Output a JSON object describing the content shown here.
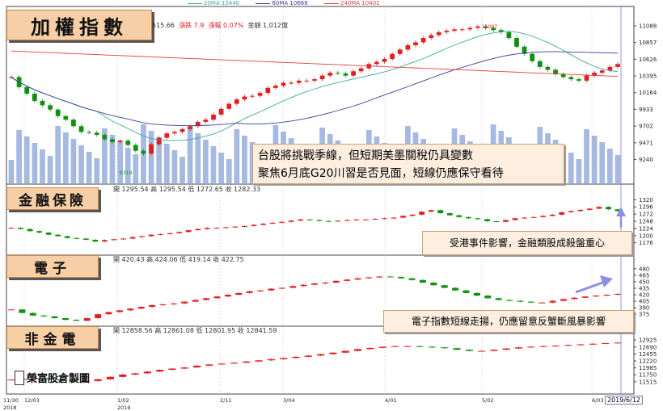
{
  "legend": [
    {
      "label": "20MA 10440",
      "color": "#3aaa9a"
    },
    {
      "label": "60MA 10668",
      "color": "#3b3b9e"
    },
    {
      "label": "240MA 10401",
      "color": "#e04040"
    }
  ],
  "titles": {
    "taiex": "加權指數",
    "finance": "金融保險",
    "electronics": "電子",
    "nonfin": "非金電"
  },
  "info": {
    "taiex": {
      "close": "515.66",
      "change": "漲跌 7.9",
      "pct": "漲幅 0.07%",
      "volume": "金額 1,012億"
    },
    "finance": "開 1295.54 高 1295.54 低 1272.65 收 1282.33",
    "electronics": "開 420.43 高 424.06 低 419.14 收 422.75",
    "nonfin": "開 12858.56 高 12861.08 低 12801.95 收 12841.59"
  },
  "callouts": {
    "taiex_line1": "台股將挑戰季線，但短期美墨關稅仍具變數",
    "taiex_line2": "聚焦6月底G20川習是否見面，短線仍應保守看待",
    "finance": "受港事件影響，金融類股成殺盤重心",
    "electronics": "電子指數短線走揚，仍應留意反蟹斷風暴影響"
  },
  "logo_text": "榮富股倉製圖",
  "date_label": "2019/6/12",
  "colors": {
    "up": "#e02020",
    "down": "#109010",
    "ma20": "#3aaa9a",
    "ma60": "#3b3b9e",
    "ma240": "#e04040",
    "volume": "#90a8d8",
    "arrow": "#8f8fe6"
  },
  "chart_data": [
    {
      "type": "candlestick",
      "name": "加權指數",
      "ylim": [
        9100,
        11200
      ],
      "y_ticks": [
        11088,
        10857,
        10626,
        10395,
        10164,
        9933,
        9702,
        9471,
        9240
      ],
      "x_labels": [
        "11/30 2018",
        "12/03",
        "1/02 2019",
        "2/11",
        "3/04",
        "4/01",
        "5/02",
        "6/03"
      ],
      "annotations": {
        "high": "11097",
        "low": "9319"
      },
      "close_series": [
        10380,
        10240,
        10150,
        10050,
        9990,
        9930,
        9840,
        9790,
        9700,
        9620,
        9610,
        9580,
        9520,
        9480,
        9500,
        9440,
        9360,
        9320,
        9450,
        9540,
        9600,
        9620,
        9660,
        9700,
        9760,
        9790,
        9860,
        9940,
        10010,
        10070,
        10110,
        10120,
        10160,
        10230,
        10260,
        10300,
        10300,
        10330,
        10330,
        10350,
        10400,
        10440,
        10430,
        10400,
        10460,
        10500,
        10560,
        10590,
        10630,
        10700,
        10760,
        10820,
        10860,
        10920,
        10960,
        11000,
        11020,
        11040,
        11040,
        11060,
        11080,
        11060,
        11030,
        11000,
        10920,
        10800,
        10700,
        10600,
        10520,
        10480,
        10420,
        10380,
        10350,
        10330,
        10400,
        10440,
        10470,
        10520,
        10560
      ]
    },
    {
      "type": "candlestick",
      "name": "金融保險",
      "y_ticks": [
        1320,
        1296,
        1272,
        1248,
        1224,
        1200,
        1176
      ],
      "close_series": [
        1226,
        1222,
        1215,
        1210,
        1203,
        1198,
        1192,
        1190,
        1186,
        1180,
        1185,
        1188,
        1190,
        1195,
        1198,
        1203,
        1205,
        1208,
        1212,
        1218,
        1222,
        1226,
        1226,
        1228,
        1230,
        1232,
        1236,
        1240,
        1243,
        1246,
        1250,
        1254,
        1252,
        1249,
        1248,
        1250,
        1252,
        1254,
        1254,
        1256,
        1258,
        1260,
        1266,
        1270,
        1280,
        1285,
        1275,
        1268,
        1262,
        1258,
        1255,
        1248,
        1246,
        1252,
        1258,
        1260,
        1262,
        1266,
        1270,
        1278,
        1282,
        1286,
        1290,
        1296,
        1288,
        1282
      ]
    },
    {
      "type": "candlestick",
      "name": "電子",
      "y_ticks": [
        480,
        465,
        450,
        435,
        420,
        405,
        390,
        375
      ],
      "close_series": [
        386,
        378,
        372,
        370,
        366,
        362,
        360,
        366,
        375,
        380,
        384,
        388,
        392,
        396,
        398,
        400,
        404,
        408,
        412,
        416,
        420,
        424,
        428,
        430,
        434,
        436,
        440,
        443,
        446,
        448,
        452,
        455,
        458,
        460,
        462,
        461,
        458,
        454,
        448,
        442,
        436,
        430,
        424,
        418,
        412,
        408,
        406,
        404,
        402,
        402,
        406,
        410,
        413,
        416,
        418,
        420,
        422
      ]
    },
    {
      "type": "candlestick",
      "name": "非金電",
      "y_ticks": [
        12925,
        12690,
        12455,
        12220,
        11985,
        11750,
        11515
      ],
      "close_series": [
        11590,
        11620,
        11640,
        11600,
        11560,
        11500,
        11540,
        11600,
        11680,
        11760,
        11800,
        11860,
        11920,
        11960,
        12000,
        12060,
        12100,
        12130,
        12160,
        12200,
        12240,
        12280,
        12320,
        12360,
        12400,
        12450,
        12500,
        12560,
        12620,
        12660,
        12700,
        12720,
        12720,
        12700,
        12680,
        12650,
        12600,
        12560,
        12560,
        12600,
        12640,
        12680,
        12700,
        12720,
        12740,
        12760,
        12780,
        12800,
        12820,
        12840
      ]
    }
  ]
}
